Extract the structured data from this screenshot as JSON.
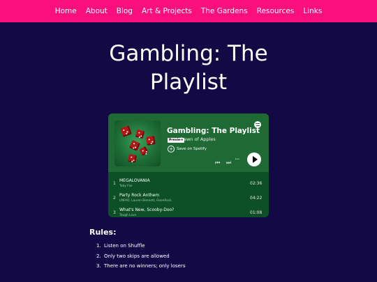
{
  "nav": {
    "items": [
      {
        "label": "Home"
      },
      {
        "label": "About"
      },
      {
        "label": "Blog"
      },
      {
        "label": "Art & Projects"
      },
      {
        "label": "The Gardens"
      },
      {
        "label": "Resources"
      },
      {
        "label": "Links"
      }
    ]
  },
  "page": {
    "title_line1": "Gambling: The",
    "title_line2": "Playlist"
  },
  "embed": {
    "playlist_title": "Gambling: The Playlist",
    "preview_badge": "Preview",
    "artist": "Dawn of Apples",
    "save_label": "Save on Spotify",
    "icons": [
      "spotify-logo",
      "previous",
      "next",
      "more",
      "play"
    ],
    "colors": {
      "header_bg": "#1f6a34",
      "list_bg": "#0d4f26"
    },
    "tracks": [
      {
        "num": "1",
        "name": "MEGALOVANIA",
        "artists": "Toby Fox",
        "duration": "02:36"
      },
      {
        "num": "2",
        "name": "Party Rock Anthem",
        "artists": "LMFAO, Lauren Bennett, GoonRock",
        "duration": "04:22"
      },
      {
        "num": "3",
        "name": "What's New, Scooby-Doo?",
        "artists": "Tough Love",
        "duration": "01:08"
      }
    ]
  },
  "rules": {
    "heading": "Rules:",
    "items": [
      {
        "num": "1.",
        "text": "Listen on Shuffle"
      },
      {
        "num": "2.",
        "text": "Only two skips are allowed"
      },
      {
        "num": "3.",
        "text": "There are no winners; only losers"
      }
    ]
  },
  "colors": {
    "nav_bg": "#fb0f7d",
    "page_bg": "#130a45"
  }
}
